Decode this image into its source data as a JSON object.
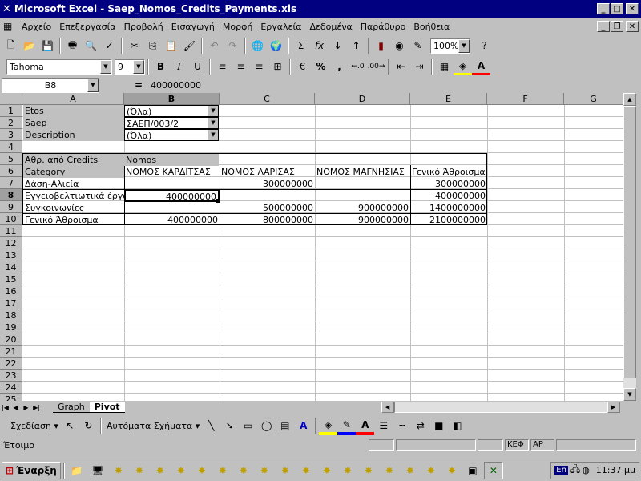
{
  "window": {
    "title": "Microsoft Excel - Saep_Nomos_Credits_Payments.xls"
  },
  "menu": [
    "Αρχείο",
    "Επεξεργασία",
    "Προβολή",
    "Εισαγωγή",
    "Μορφή",
    "Εργαλεία",
    "Δεδομένα",
    "Παράθυρο",
    "Βοήθεια"
  ],
  "toolbar": {
    "zoom": "100%"
  },
  "format_toolbar": {
    "font": "Tahoma",
    "size": "9",
    "bold": "B",
    "italic": "I",
    "underline": "U",
    "percent": "%",
    "comma": ","
  },
  "formula": {
    "name_box": "B8",
    "equals": "=",
    "value": "400000000"
  },
  "columns": [
    "A",
    "B",
    "C",
    "D",
    "E",
    "F",
    "G"
  ],
  "rows": [
    "1",
    "2",
    "3",
    "4",
    "5",
    "6",
    "7",
    "8",
    "9",
    "10",
    "11",
    "12",
    "13",
    "14",
    "15",
    "16",
    "17",
    "18",
    "19",
    "20",
    "21",
    "22",
    "23",
    "24",
    "25"
  ],
  "cells": {
    "a1": "Etos",
    "b1": "(Όλα)",
    "a2": "Saep",
    "b2": "ΣΑΕΠ/003/2",
    "a3": "Description",
    "b3": "(Όλα)",
    "a5": "Αθρ. από Credits",
    "b5": "Nomos",
    "a6": "Category",
    "b6": "ΝΟΜΟΣ ΚΑΡΔΙΤΣΑΣ",
    "c6": "ΝΟΜΟΣ ΛΑΡΙΣΑΣ",
    "d6": "ΝΟΜΟΣ ΜΑΓΝΗΣΙΑΣ",
    "e6": "Γενικό Άθροισμα",
    "a7": "Δάση-Αλιεία",
    "c7": "300000000",
    "e7": "300000000",
    "a8": "Εγγειοβελτιωτικά έργα",
    "b8": "400000000",
    "e8": "400000000",
    "a9": "Συγκοινωνίες",
    "c9": "500000000",
    "d9": "900000000",
    "e9": "1400000000",
    "a10": "Γενικό Άθροισμα",
    "b10": "400000000",
    "c10": "800000000",
    "d10": "900000000",
    "e10": "2100000000"
  },
  "sheet_tabs": [
    "Graph",
    "Pivot"
  ],
  "drawing": {
    "draw_label": "Σχεδίαση",
    "autoshapes_label": "Αυτόματα Σχήματα"
  },
  "status": {
    "ready": "Έτοιμο",
    "caps": "ΚΕΦ",
    "num": "ΑΡ"
  },
  "taskbar": {
    "start_label": "Έναρξη",
    "lang": "En",
    "clock": "11:37 μμ"
  }
}
